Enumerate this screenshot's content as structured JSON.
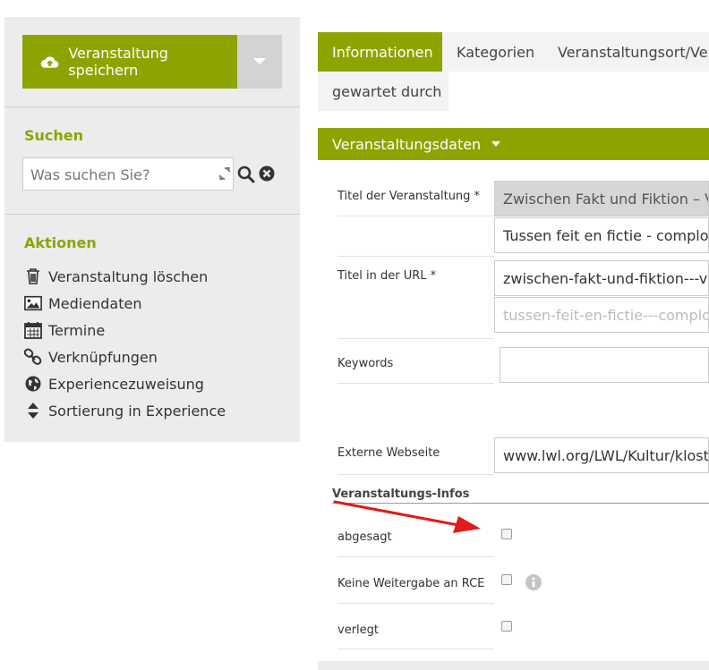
{
  "sidebar": {
    "save_label": "Veranstaltung speichern",
    "search_title": "Suchen",
    "search_placeholder": "Was suchen Sie?",
    "actions_title": "Aktionen",
    "actions": [
      {
        "label": "Veranstaltung löschen",
        "icon": "trash-icon"
      },
      {
        "label": "Mediendaten",
        "icon": "image-icon"
      },
      {
        "label": "Termine",
        "icon": "calendar-icon"
      },
      {
        "label": "Verknüpfungen",
        "icon": "link-icon"
      },
      {
        "label": "Experiencezuweisung",
        "icon": "globe-icon"
      },
      {
        "label": "Sortierung in Experience",
        "icon": "sort-icon"
      }
    ]
  },
  "tabs": [
    "Informationen",
    "Kategorien",
    "Veranstaltungsort/Vera",
    "gewartet durch"
  ],
  "section": {
    "title": "Veranstaltungsdaten"
  },
  "form": {
    "title_label": "Titel der Veranstaltung *",
    "title_value_de": "Zwischen Fakt und Fiktion – Ver",
    "title_value_nl": "Tussen feit en fictie - complotth",
    "url_label": "Titel in der URL *",
    "url_value_de": "zwischen-fakt-und-fiktion---vers",
    "url_placeholder_nl": "tussen-feit-en-fictie---complotth",
    "keywords_label": "Keywords",
    "keywords_value": "",
    "website_label": "Externe Webseite",
    "website_value": "www.lwl.org/LWL/Kultur/kloste"
  },
  "infos": {
    "heading": "Veranstaltungs-Infos",
    "abgesagt": "abgesagt",
    "rce": "Keine Weitergabe an RCE",
    "verlegt": "verlegt",
    "abgesagt_checked": false,
    "rce_checked": false,
    "verlegt_checked": false
  },
  "colors": {
    "accent": "#8da400",
    "arrow": "#e01b1b"
  }
}
